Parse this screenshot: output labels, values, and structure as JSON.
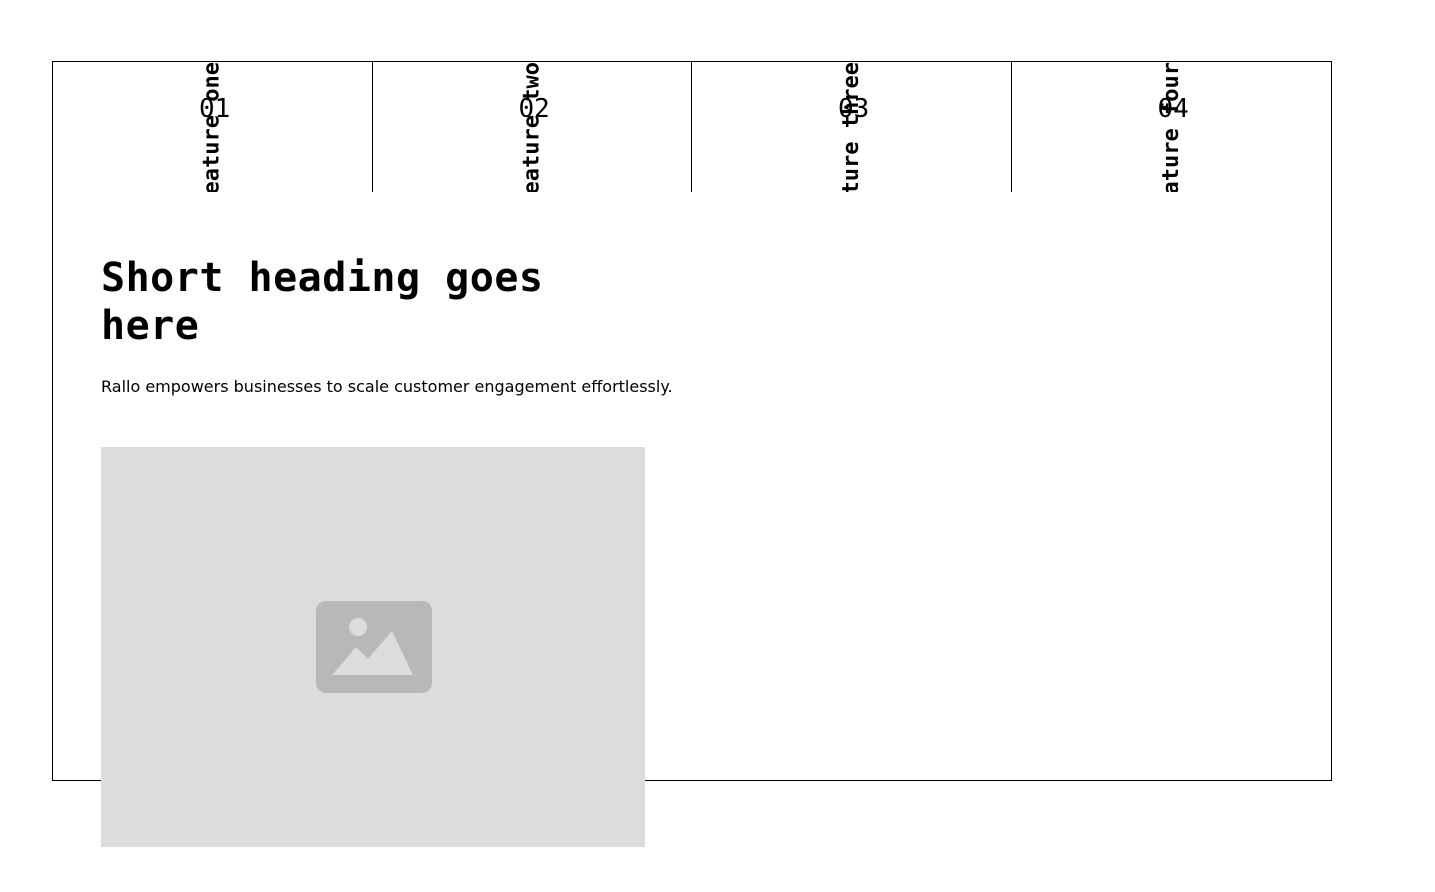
{
  "tabs": [
    {
      "label": "Feature one",
      "number": "01"
    },
    {
      "label": "Feature two",
      "number": "02"
    },
    {
      "label": "Feature three",
      "number": "03"
    },
    {
      "label": "Feature four",
      "number": "04"
    }
  ],
  "main": {
    "heading": "Short heading goes here",
    "description": "Rallo empowers businesses to scale customer engagement effortlessly.",
    "image_icon": "image-placeholder-icon"
  },
  "colors": {
    "border": "#000000",
    "placeholder_bg": "#dcdcdc",
    "placeholder_icon": "#b8b8b8"
  }
}
